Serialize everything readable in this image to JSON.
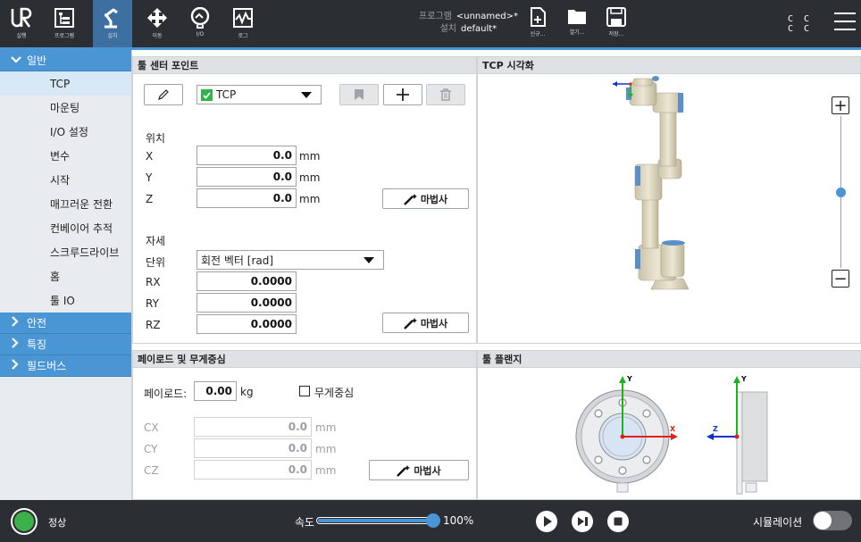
{
  "topbar": {
    "tabs": [
      {
        "label": "실행",
        "icon": "ur-logo-icon"
      },
      {
        "label": "프로그램",
        "icon": "program-icon"
      },
      {
        "label": "설치",
        "icon": "installation-icon"
      },
      {
        "label": "이동",
        "icon": "move-icon"
      },
      {
        "label": "I/O",
        "icon": "io-icon"
      },
      {
        "label": "로그",
        "icon": "log-icon"
      }
    ],
    "program_key": "프로그램",
    "program_value": "<unnamed>*",
    "install_key": "설치",
    "install_value": "default*",
    "file_buttons": [
      {
        "label": "신규...",
        "icon": "new-file-icon"
      },
      {
        "label": "열기...",
        "icon": "open-folder-icon"
      },
      {
        "label": "저장...",
        "icon": "save-icon"
      }
    ],
    "cc_line1": "C C",
    "cc_line2": "C C",
    "active_tab_color": "#3d6fa1",
    "accent_color": "#4a96d4"
  },
  "sidebar": {
    "general_label": "일반",
    "items": [
      "TCP",
      "마운팅",
      "I/O 설정",
      "변수",
      "시작",
      "매끄러운 전환",
      "컨베이어 추적",
      "스크루드라이브",
      "홈",
      "툴 IO"
    ],
    "selected": "TCP",
    "groups": [
      "안전",
      "특징",
      "필드버스"
    ]
  },
  "tcp_panel": {
    "title": "툴 센터 포인트",
    "tcp_select": "TCP",
    "position_label": "위치",
    "x_label": "X",
    "x_value": "0.0",
    "y_label": "Y",
    "y_value": "0.0",
    "z_label": "Z",
    "z_value": "0.0",
    "unit_mm": "mm",
    "wizard_label": "마법사",
    "orientation_label": "자세",
    "unit_label": "단위",
    "unit_select": "회전 벡터 [rad]",
    "rx_label": "RX",
    "rx_value": "0.0000",
    "ry_label": "RY",
    "ry_value": "0.0000",
    "rz_label": "RZ",
    "rz_value": "0.0000"
  },
  "tcp_view": {
    "title": "TCP 시각화",
    "zoom_plus": "+",
    "zoom_minus": "−",
    "zoom_level": 0.5
  },
  "payload_panel": {
    "title": "페이로드 및 무게중심",
    "payload_label": "페이로드:",
    "payload_value": "0.00",
    "payload_unit": "kg",
    "cog_label": "무게중심",
    "cx_label": "CX",
    "cx_value": "0.0",
    "cy_label": "CY",
    "cy_value": "0.0",
    "cz_label": "CZ",
    "cz_value": "0.0",
    "unit_mm": "mm",
    "wizard_label": "마법사"
  },
  "flange_panel": {
    "title": "툴 플랜지",
    "axis_y": "Y",
    "axis_x": "X",
    "axis_z": "Z"
  },
  "bottombar": {
    "status": "정상",
    "status_color": "#3cb04a",
    "speed_label": "속도",
    "speed_value": "100%",
    "speed_fraction": 1.0,
    "simulation_label": "시뮬레이션"
  }
}
